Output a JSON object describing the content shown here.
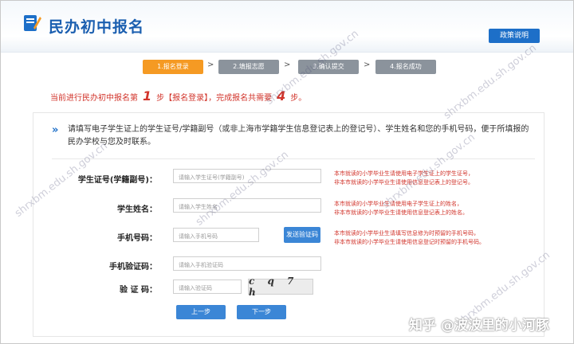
{
  "header": {
    "brand": "民办初中报名",
    "policy_button": "政策说明"
  },
  "steps": [
    {
      "label": "1.报名登录",
      "state": "active"
    },
    {
      "label": "2.填报志愿",
      "state": "inactive"
    },
    {
      "label": "3.确认提交",
      "state": "inactive"
    },
    {
      "label": "4.报名成功",
      "state": "inactive"
    }
  ],
  "progress": {
    "prefix": "当前进行民办初中报名第",
    "current": "1",
    "middle": "步【报名登录】，完成报名共需要",
    "total": "4",
    "suffix": "步。"
  },
  "intro_text": "请填写电子学生证上的学生证号/学籍副号（或非上海市学籍学生信息登记表上的登记号）、学生姓名和您的手机号码，便于所填报的民办学校与您及时联系。",
  "form": {
    "student_id": {
      "label": "学生证号(学籍副号)：",
      "placeholder": "请输入学生证号(学籍副号)",
      "hint1": "本市就读的小学毕业生请使用电子学生证上的学生证号，",
      "hint2": "非本市就读的小学毕业生请使用信息登记表上的登记号。"
    },
    "student_name": {
      "label": "学生姓名：",
      "placeholder": "请输入学生姓名",
      "hint1": "本市就读的小学毕业生请使用电子学生证上的姓名，",
      "hint2": "非本市就读的小学毕业生请使用信息登记表上的姓名。"
    },
    "phone": {
      "label": "手机号码：",
      "placeholder": "请输入手机号码",
      "sms_button": "发送验证码",
      "hint1": "本市就读的小学毕业生请填写信息修为时预留的手机号码，",
      "hint2": "非本市就读的小学毕业生请使用信息登记时预留的手机号码。"
    },
    "sms_code": {
      "label": "手机验证码：",
      "placeholder": "请输入手机验证码"
    },
    "captcha": {
      "label": "验 证 码：",
      "placeholder": "请输入验证码",
      "image_text": "c q 7 h"
    }
  },
  "buttons": {
    "prev": "上一步",
    "next": "下一步"
  },
  "watermark": "shrxbm.edu.sh.gov.cn",
  "overlay": "知乎 @波波里的小河豚",
  "colors": {
    "accent": "#1d6fc8",
    "active_step": "#f59a23",
    "hint_red": "#d2352c"
  }
}
